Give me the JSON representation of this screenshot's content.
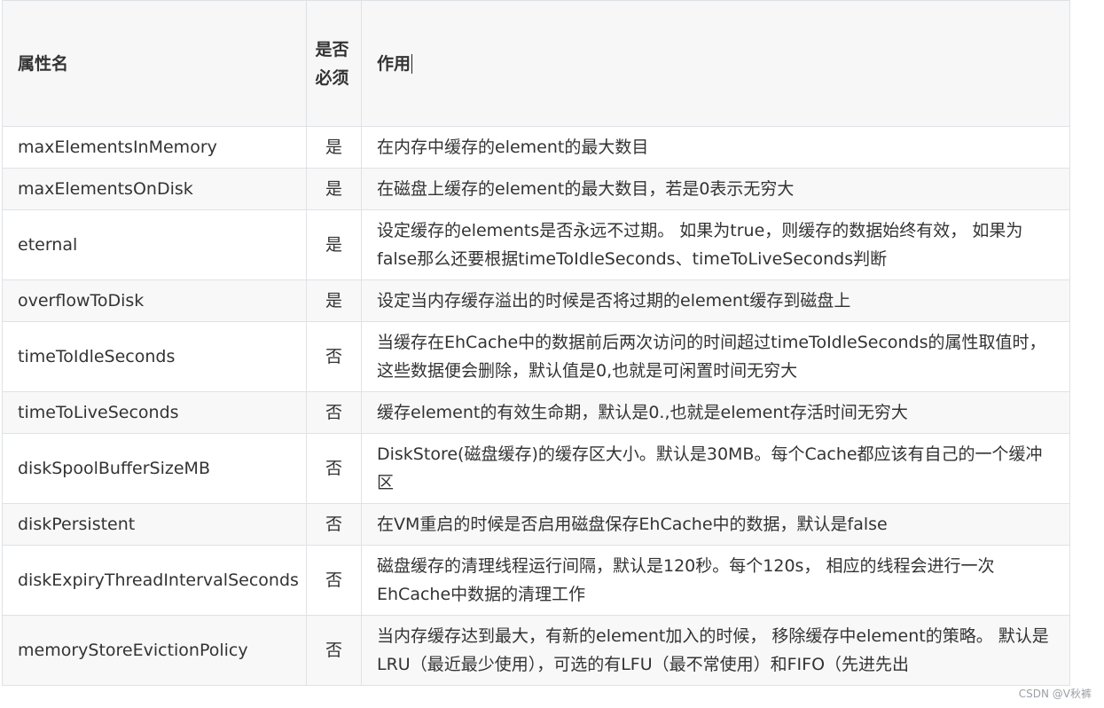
{
  "table": {
    "headers": [
      "属性名",
      "是否必须",
      "作用"
    ],
    "rows": [
      {
        "name": "maxElementsInMemory",
        "required": "是",
        "desc": "在内存中缓存的element的最大数目"
      },
      {
        "name": "maxElementsOnDisk",
        "required": "是",
        "desc": "在磁盘上缓存的element的最大数目，若是0表示无穷大"
      },
      {
        "name": "eternal",
        "required": "是",
        "desc": "设定缓存的elements是否永远不过期。 如果为true，则缓存的数据始终有效， 如果为false那么还要根据timeToIdleSeconds、timeToLiveSeconds判断"
      },
      {
        "name": "overflowToDisk",
        "required": "是",
        "desc": "设定当内存缓存溢出的时候是否将过期的element缓存到磁盘上"
      },
      {
        "name": "timeToIdleSeconds",
        "required": "否",
        "desc": "当缓存在EhCache中的数据前后两次访问的时间超过timeToIdleSeconds的属性取值时， 这些数据便会删除，默认值是0,也就是可闲置时间无穷大"
      },
      {
        "name": "timeToLiveSeconds",
        "required": "否",
        "desc": "缓存element的有效生命期，默认是0.,也就是element存活时间无穷大"
      },
      {
        "name": "diskSpoolBufferSizeMB",
        "required": "否",
        "desc": "DiskStore(磁盘缓存)的缓存区大小。默认是30MB。每个Cache都应该有自己的一个缓冲区"
      },
      {
        "name": "diskPersistent",
        "required": "否",
        "desc": "在VM重启的时候是否启用磁盘保存EhCache中的数据，默认是false"
      },
      {
        "name": "diskExpiryThreadIntervalSeconds",
        "required": "否",
        "desc": "磁盘缓存的清理线程运行间隔，默认是120秒。每个120s， 相应的线程会进行一次EhCache中数据的清理工作"
      },
      {
        "name": "memoryStoreEvictionPolicy",
        "required": "否",
        "desc": "当内存缓存达到最大，有新的element加入的时候， 移除缓存中element的策略。 默认是LRU（最近最少使用），可选的有LFU（最不常使用）和FIFO（先进先出"
      }
    ]
  },
  "watermark": "CSDN @V秋裤"
}
